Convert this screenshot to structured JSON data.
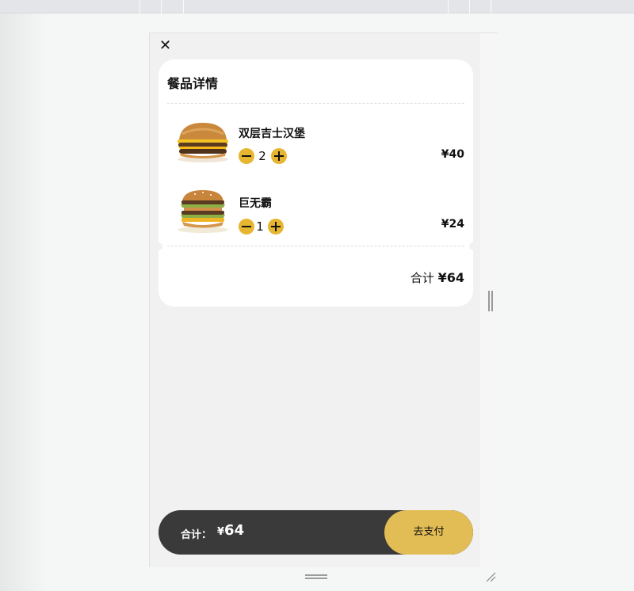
{
  "window": {
    "close_glyph": "✕"
  },
  "order": {
    "title": "餐品详情",
    "items": [
      {
        "name": "双层吉士汉堡",
        "quantity": "2",
        "price": "¥40",
        "image_icon": "double-cheeseburger-image"
      },
      {
        "name": "巨无霸",
        "quantity": "1",
        "price": "¥24",
        "image_icon": "big-mac-image"
      }
    ],
    "subtotal_label": "合计",
    "subtotal_amount": "¥64"
  },
  "checkout": {
    "total_label": "合计：",
    "total_currency": "¥",
    "total_value": "64",
    "pay_label": "去支付"
  },
  "colors": {
    "accent": "#e6b630",
    "pay_button": "#e2bc54",
    "bar": "#3a3a3a"
  }
}
